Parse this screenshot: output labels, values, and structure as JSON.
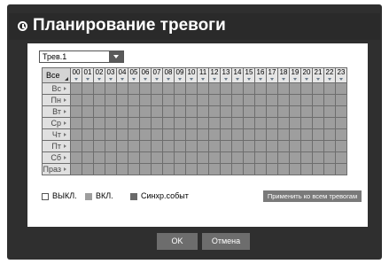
{
  "window": {
    "title": "Планирование тревоги"
  },
  "alarm_select": {
    "value": "Трев.1"
  },
  "grid": {
    "corner_label": "Все",
    "hours": [
      "00",
      "01",
      "02",
      "03",
      "04",
      "05",
      "06",
      "07",
      "08",
      "09",
      "10",
      "11",
      "12",
      "13",
      "14",
      "15",
      "16",
      "17",
      "18",
      "19",
      "20",
      "21",
      "22",
      "23"
    ],
    "days": [
      "Вс",
      "Пн",
      "Вт",
      "Ср",
      "Чт",
      "Пт",
      "Сб",
      "Праз"
    ]
  },
  "legend": {
    "off_label": "ВЫКЛ.",
    "on_label": "ВКЛ.",
    "sync_label": "Синхр.событ",
    "colors": {
      "off": "#ffffff",
      "on": "#9e9e9e",
      "sync": "#6a6a6a"
    }
  },
  "buttons": {
    "apply_all": "Применить ко всем тревогам",
    "ok": "OK",
    "cancel": "Отмена"
  }
}
